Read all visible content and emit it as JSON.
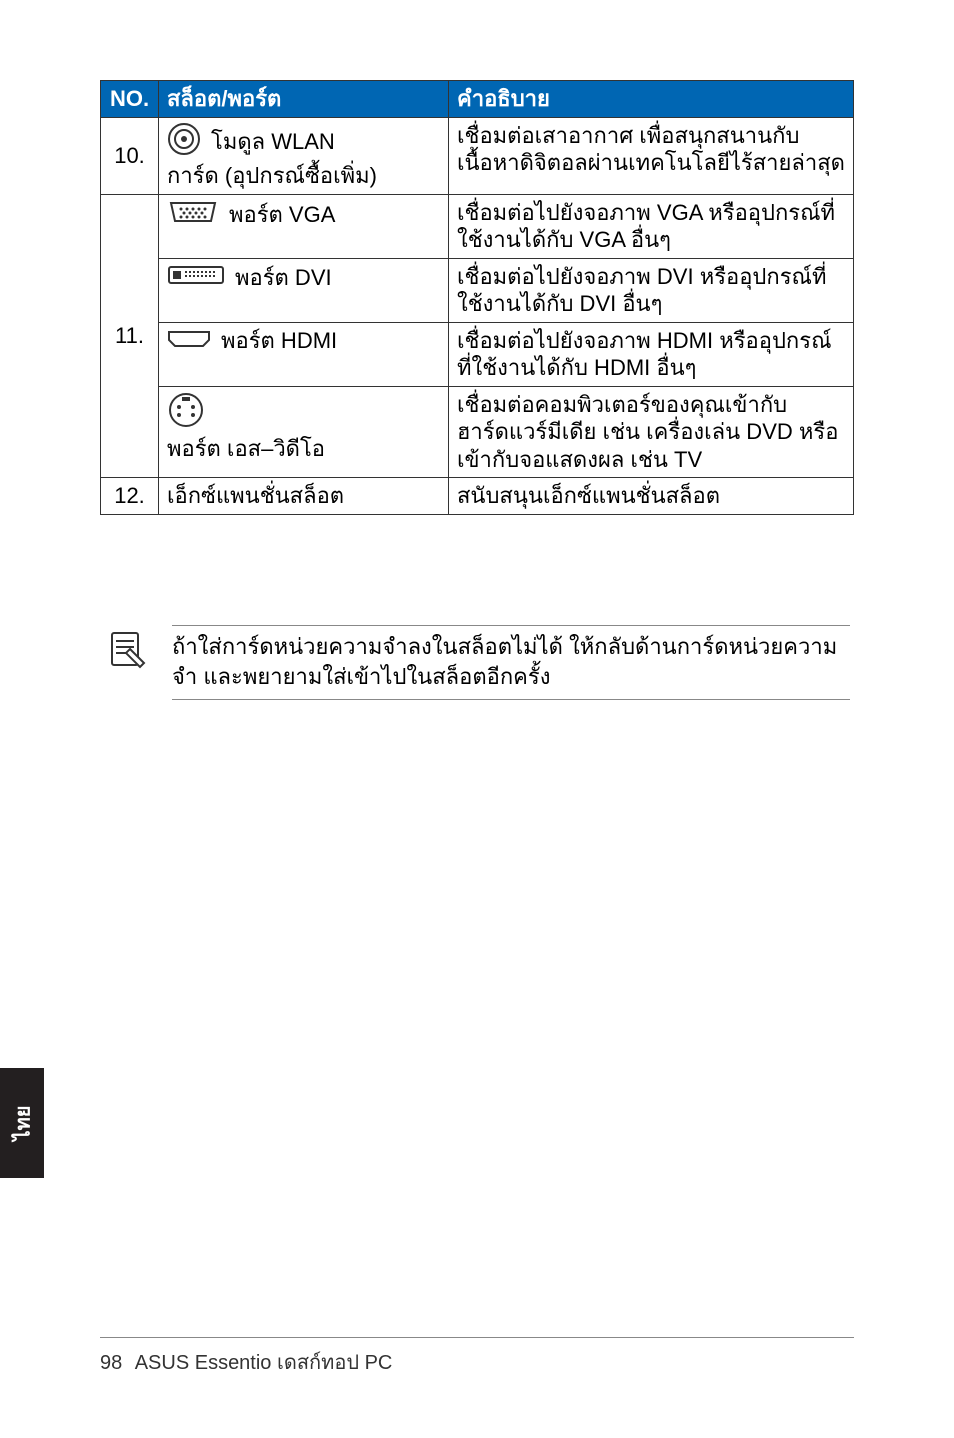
{
  "table": {
    "headers": {
      "no": "NO.",
      "slot": "สล็อต/พอร์ต",
      "desc": "คำอธิบาย"
    },
    "row10": {
      "no": "10.",
      "slot_line1": "โมดูล WLAN",
      "slot_line2": "การ์ด (อุปกรณ์ซื้อเพิ่ม)",
      "desc": "เชื่อมต่อเสาอากาศ เพื่อสนุกสนานกับเนื้อหาดิจิตอลผ่านเทคโนโลยีไร้สายล่าสุด"
    },
    "row11": {
      "no": "11.",
      "vga": {
        "label": "พอร์ต VGA",
        "desc": "เชื่อมต่อไปยังจอภาพ VGA หรืออุปกรณ์ที่ใช้งานได้กับ VGA อื่นๆ"
      },
      "dvi": {
        "label": "พอร์ต DVI",
        "desc": "เชื่อมต่อไปยังจอภาพ DVI หรืออุปกรณ์ที่ใช้งานได้กับ DVI อื่นๆ"
      },
      "hdmi": {
        "label": "พอร์ต HDMI",
        "desc": "เชื่อมต่อไปยังจอภาพ HDMI หรืออุปกรณ์ที่ใช้งานได้กับ HDMI อื่นๆ"
      },
      "svideo": {
        "label": "พอร์ต เอส–วิดีโอ",
        "desc": "เชื่อมต่อคอมพิวเตอร์ของคุณเข้ากับฮาร์ดแวร์มีเดีย เช่น เครื่องเล่น DVD หรือเข้ากับจอแสดงผล เช่น TV"
      }
    },
    "row12": {
      "no": "12.",
      "slot": "เอ็กซ์แพนชั่นสล็อต",
      "desc": "สนับสนุนเอ็กซ์แพนชั่นสล็อต"
    }
  },
  "note": "ถ้าใส่การ์ดหน่วยความจำลงในสล็อตไม่ได้ ให้กลับด้านการ์ดหน่วยความจำ และพยายามใส่เข้าไปในสล็อตอีกครั้ง",
  "side_tab": "ไทย",
  "footer": {
    "page": "98",
    "title": "ASUS Essentio เดสก์ทอป PC"
  }
}
